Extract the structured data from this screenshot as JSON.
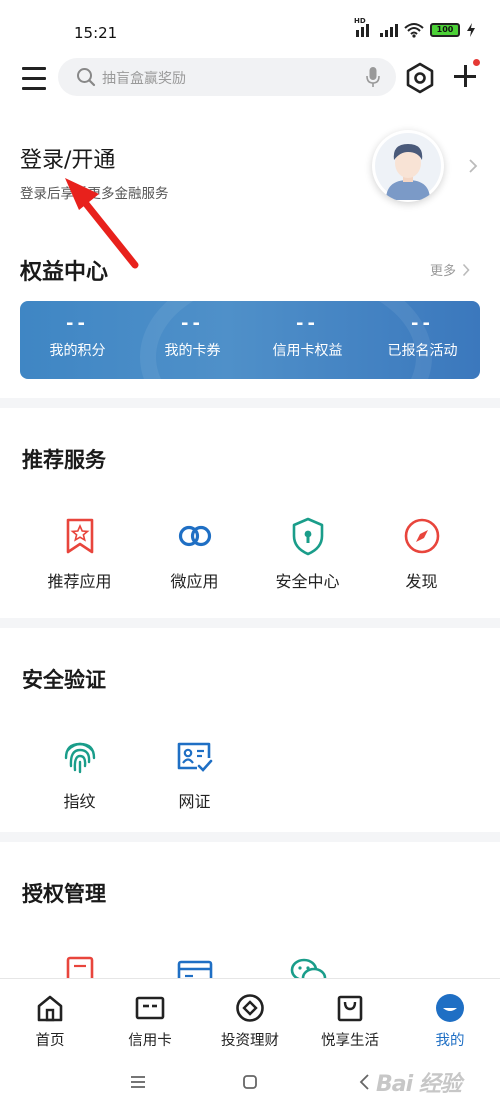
{
  "status_bar": {
    "time": "15:21",
    "network_badge": "HD",
    "battery": "100",
    "wifi_icon": "wifi-icon",
    "charging_icon": "bolt-icon"
  },
  "top_bar": {
    "menu_icon": "hamburger-menu-icon",
    "search_placeholder": "抽盲盒赢奖励",
    "search_icon": "search-icon",
    "mic_icon": "microphone-icon",
    "scan_icon": "hexagon-settings-icon",
    "add_icon": "plus-icon",
    "notification_dot_color": "#e53935"
  },
  "profile": {
    "title": "登录/开通",
    "subtitle": "登录后享受更多金融服务",
    "avatar_icon": "user-avatar-icon",
    "chevron_icon": "chevron-right-icon"
  },
  "benefits": {
    "title": "权益中心",
    "more_label": "更多",
    "card_color": "#4a8bc7",
    "items": [
      {
        "value": "--",
        "label": "我的积分"
      },
      {
        "value": "--",
        "label": "我的卡券"
      },
      {
        "value": "--",
        "label": "信用卡权益"
      },
      {
        "value": "--",
        "label": "已报名活动"
      }
    ]
  },
  "recommended": {
    "title": "推荐服务",
    "items": [
      {
        "label": "推荐应用",
        "icon": "star-bookmark-icon",
        "color": "#e8453c"
      },
      {
        "label": "微应用",
        "icon": "link-rings-icon",
        "color": "#1f6fc4"
      },
      {
        "label": "安全中心",
        "icon": "shield-lock-icon",
        "color": "#1a9d8a"
      },
      {
        "label": "发现",
        "icon": "compass-icon",
        "color": "#e8453c"
      }
    ]
  },
  "security": {
    "title": "安全验证",
    "items": [
      {
        "label": "指纹",
        "icon": "fingerprint-icon",
        "color": "#1a9d8a"
      },
      {
        "label": "网证",
        "icon": "id-card-check-icon",
        "color": "#1f6fc4"
      }
    ]
  },
  "authorization": {
    "title": "授权管理",
    "items": [
      {
        "icon": "document-icon",
        "color": "#e8453c"
      },
      {
        "icon": "card-icon",
        "color": "#1f6fc4"
      },
      {
        "icon": "wechat-icon",
        "color": "#1a9d8a"
      }
    ]
  },
  "bottom_nav": {
    "active_color": "#1f6fc4",
    "items": [
      {
        "label": "首页",
        "icon": "home-icon"
      },
      {
        "label": "信用卡",
        "icon": "credit-card-icon"
      },
      {
        "label": "投资理财",
        "icon": "investment-icon"
      },
      {
        "label": "悦享生活",
        "icon": "shopping-bag-icon"
      },
      {
        "label": "我的",
        "icon": "profile-active-icon"
      }
    ]
  },
  "system_nav": {
    "menu": "recent-apps-icon",
    "home": "home-square-icon",
    "back": "back-chevron-icon"
  },
  "watermark": "Bai 经验"
}
